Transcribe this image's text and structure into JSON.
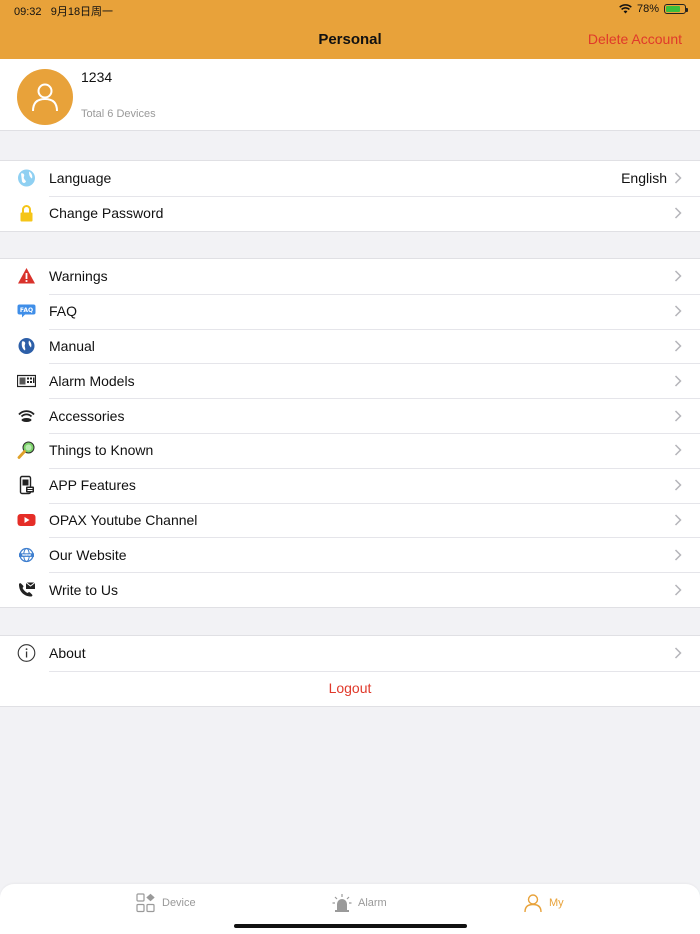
{
  "status_bar": {
    "time": "09:32",
    "date": "9月18日周一",
    "battery": "78%",
    "battery_level": 0.78
  },
  "nav": {
    "title": "Personal",
    "right_action": "Delete Account"
  },
  "profile": {
    "name": "1234",
    "subtitle": "Total 6 Devices"
  },
  "settings": [
    {
      "label": "Language",
      "value": "English",
      "icon": "globe-icon"
    },
    {
      "label": "Change Password",
      "icon": "lock-icon"
    }
  ],
  "menu": [
    {
      "label": "Warnings",
      "icon": "warning-icon"
    },
    {
      "label": "FAQ",
      "icon": "faq-icon"
    },
    {
      "label": "Manual",
      "icon": "manual-globe-icon"
    },
    {
      "label": "Alarm Models",
      "icon": "alarm-panel-icon"
    },
    {
      "label": "Accessories",
      "icon": "wifi-sensor-icon"
    },
    {
      "label": "Things to Known",
      "icon": "magnifier-icon"
    },
    {
      "label": "APP Features",
      "icon": "phone-features-icon"
    },
    {
      "label": "OPAX Youtube Channel",
      "icon": "youtube-icon"
    },
    {
      "label": "Our Website",
      "icon": "www-icon"
    },
    {
      "label": "Write to Us",
      "icon": "mail-phone-icon"
    }
  ],
  "about": {
    "label": "About",
    "icon": "info-icon"
  },
  "logout": "Logout",
  "tabs": [
    {
      "label": "Device",
      "icon": "device-grid-icon",
      "active": false
    },
    {
      "label": "Alarm",
      "icon": "siren-icon",
      "active": false
    },
    {
      "label": "My",
      "icon": "person-icon",
      "active": true
    }
  ],
  "colors": {
    "accent": "#e8a23a",
    "danger": "#e0392b",
    "background": "#f2f2f5"
  }
}
